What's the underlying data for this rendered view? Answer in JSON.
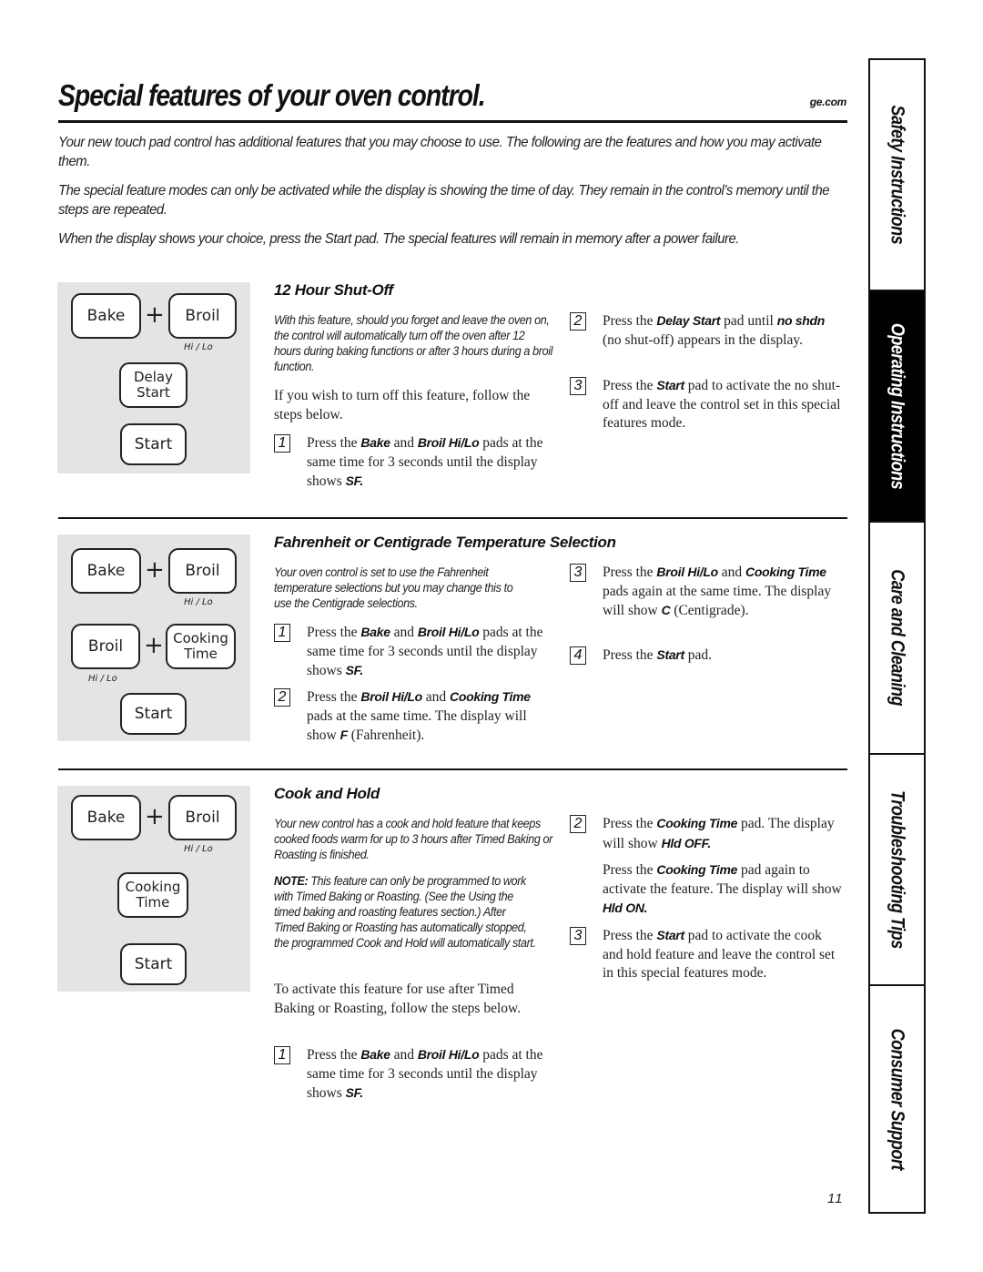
{
  "header": {
    "title": "Special features of your oven control.",
    "site": "ge.com"
  },
  "intro": [
    "Your new touch pad control has additional features that you may choose to use. The following are the features and how you may activate them.",
    "The special feature modes can only be activated while the display is showing the time of day. They remain in the control’s memory until the steps are repeated.",
    "When the display shows your choice, press the Start pad. The special features will remain in memory after a power failure."
  ],
  "pads": {
    "bake": "Bake",
    "broil": "Broil",
    "hilo": "Hi / Lo",
    "plus": "+",
    "delay_start_1": "Delay",
    "delay_start_2": "Start",
    "start": "Start",
    "cooking_time_1": "Cooking",
    "cooking_time_2": "Time"
  },
  "sections": {
    "shutoff": {
      "heading": "12 Hour Shut-Off",
      "description": "With this feature, should you forget and leave the oven on, the control will automatically turn off the oven after 12 hours during baking functions or after 3 hours during a broil function.",
      "lead": "If you wish to turn off this feature, follow the steps below.",
      "steps": [
        {
          "num": "1",
          "pre": "Press the ",
          "k1": "Bake",
          "mid": " and ",
          "k2": "Broil Hi/Lo",
          "post": " pads at the same time for 3 seconds until the display shows ",
          "k3": "SF."
        },
        {
          "num": "2",
          "pre": "Press the ",
          "k1": "Delay Start",
          "mid": " pad until ",
          "k2": "no shdn",
          "post": " (no shut-off) appears in the display."
        },
        {
          "num": "3",
          "pre": "Press the ",
          "k1": "Start",
          "post": " pad to activate the no shut-off and leave the control set in this special features mode."
        }
      ]
    },
    "temperature": {
      "heading": "Fahrenheit or Centigrade Temperature Selection",
      "description": "Your oven control is set to use the Fahrenheit temperature selections but you may change this to use the Centigrade selections.",
      "steps": [
        {
          "num": "1",
          "pre": "Press the ",
          "k1": "Bake",
          "mid": " and ",
          "k2": "Broil Hi/Lo",
          "post": " pads at the same time for 3 seconds until the display shows ",
          "k3": "SF."
        },
        {
          "num": "2",
          "pre": "Press the ",
          "k1": "Broil Hi/Lo",
          "mid": " and ",
          "k2": "Cooking Time",
          "post": " pads at the same time. The display will show ",
          "k3": "F",
          "post2": " (Fahrenheit)."
        },
        {
          "num": "3",
          "pre": "Press the ",
          "k1": "Broil Hi/Lo",
          "mid": " and ",
          "k2": "Cooking Time",
          "post": " pads again at the same time. The display will show ",
          "k3": "C",
          "post2": "  (Centigrade)."
        },
        {
          "num": "4",
          "pre": "Press the ",
          "k1": "Start",
          "post": " pad."
        }
      ]
    },
    "cookhold": {
      "heading": "Cook and Hold",
      "description": "Your new control has a cook and hold feature that keeps cooked foods warm for up to 3 hours after Timed Baking or Roasting is finished.",
      "note_label": "NOTE:",
      "note": " This feature can only be programmed to work with Timed Baking or Roasting. (See the Using the timed baking and roasting features section.) After Timed Baking or Roasting has automatically stopped, the programmed Cook and Hold will automatically start.",
      "lead": "To activate this feature for use after Timed Baking or Roasting, follow the steps below.",
      "steps": [
        {
          "num": "1",
          "pre": "Press the ",
          "k1": "Bake",
          "mid": " and ",
          "k2": "Broil Hi/Lo",
          "post": " pads at the same time for 3 seconds until the display shows ",
          "k3": "SF."
        },
        {
          "num": "2",
          "pre": "Press the ",
          "k1": "Cooking Time",
          "post": " pad. The display will show ",
          "k3": "Hld OFF."
        },
        {
          "num": "",
          "pre": "Press the ",
          "k1": "Cooking Time",
          "post": " pad again to activate the feature. The display will show ",
          "k3": "Hld ON."
        },
        {
          "num": "3",
          "pre": "Press the ",
          "k1": "Start",
          "post": " pad to activate the cook and hold feature and leave the control set in this special features mode."
        }
      ]
    }
  },
  "sidebar": {
    "tabs": [
      {
        "label": "Safety Instructions",
        "active": false
      },
      {
        "label": "Operating Instructions",
        "active": true
      },
      {
        "label": "Care and Cleaning",
        "active": false
      },
      {
        "label": "Troubleshooting Tips",
        "active": false
      },
      {
        "label": "Consumer Support",
        "active": false
      }
    ]
  },
  "footer": {
    "page_number": "11"
  }
}
